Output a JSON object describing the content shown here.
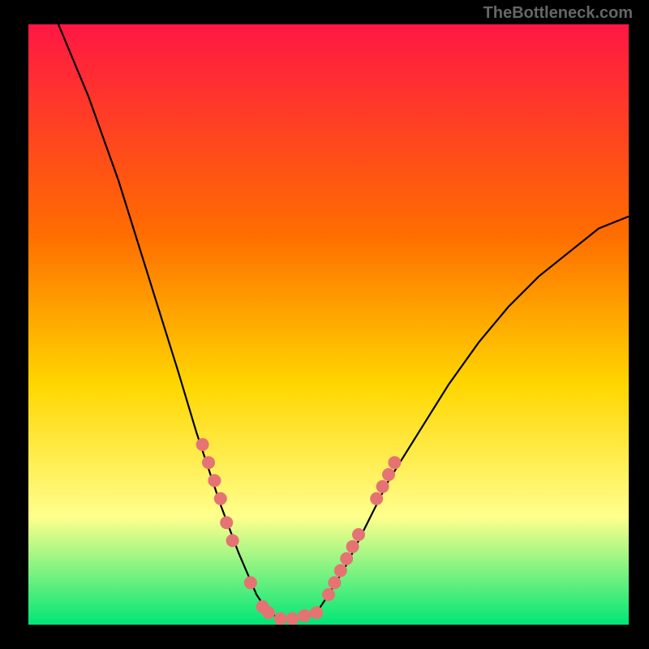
{
  "watermark": "TheBottleneck.com",
  "chart_data": {
    "type": "line",
    "title": "",
    "xlabel": "",
    "ylabel": "",
    "xlim": [
      0,
      100
    ],
    "ylim": [
      0,
      100
    ],
    "gradient_colors": {
      "top": "#ff1744",
      "upper_mid": "#ff6d00",
      "mid": "#ffd600",
      "lower_mid": "#ffff8d",
      "bottom": "#00e676"
    },
    "curve": {
      "description": "V-shaped bottleneck curve with minimum near x=42",
      "points": [
        {
          "x": 5,
          "y": 100
        },
        {
          "x": 10,
          "y": 88
        },
        {
          "x": 15,
          "y": 74
        },
        {
          "x": 20,
          "y": 58
        },
        {
          "x": 25,
          "y": 42
        },
        {
          "x": 28,
          "y": 32
        },
        {
          "x": 30,
          "y": 26
        },
        {
          "x": 32,
          "y": 20
        },
        {
          "x": 35,
          "y": 12
        },
        {
          "x": 38,
          "y": 5
        },
        {
          "x": 40,
          "y": 2
        },
        {
          "x": 42,
          "y": 1
        },
        {
          "x": 45,
          "y": 1
        },
        {
          "x": 48,
          "y": 2
        },
        {
          "x": 50,
          "y": 5
        },
        {
          "x": 53,
          "y": 10
        },
        {
          "x": 56,
          "y": 16
        },
        {
          "x": 60,
          "y": 24
        },
        {
          "x": 65,
          "y": 32
        },
        {
          "x": 70,
          "y": 40
        },
        {
          "x": 75,
          "y": 47
        },
        {
          "x": 80,
          "y": 53
        },
        {
          "x": 85,
          "y": 58
        },
        {
          "x": 90,
          "y": 62
        },
        {
          "x": 95,
          "y": 66
        },
        {
          "x": 100,
          "y": 68
        }
      ]
    },
    "markers": {
      "description": "Salmon-colored dots along lower portion of curve",
      "color": "#e57373",
      "points": [
        {
          "x": 29,
          "y": 30
        },
        {
          "x": 30,
          "y": 27
        },
        {
          "x": 31,
          "y": 24
        },
        {
          "x": 32,
          "y": 21
        },
        {
          "x": 33,
          "y": 17
        },
        {
          "x": 34,
          "y": 14
        },
        {
          "x": 37,
          "y": 7
        },
        {
          "x": 39,
          "y": 3
        },
        {
          "x": 40,
          "y": 2
        },
        {
          "x": 42,
          "y": 1
        },
        {
          "x": 44,
          "y": 1
        },
        {
          "x": 46,
          "y": 1.5
        },
        {
          "x": 48,
          "y": 2
        },
        {
          "x": 50,
          "y": 5
        },
        {
          "x": 51,
          "y": 7
        },
        {
          "x": 52,
          "y": 9
        },
        {
          "x": 53,
          "y": 11
        },
        {
          "x": 54,
          "y": 13
        },
        {
          "x": 55,
          "y": 15
        },
        {
          "x": 58,
          "y": 21
        },
        {
          "x": 59,
          "y": 23
        },
        {
          "x": 60,
          "y": 25
        },
        {
          "x": 61,
          "y": 27
        }
      ]
    }
  }
}
